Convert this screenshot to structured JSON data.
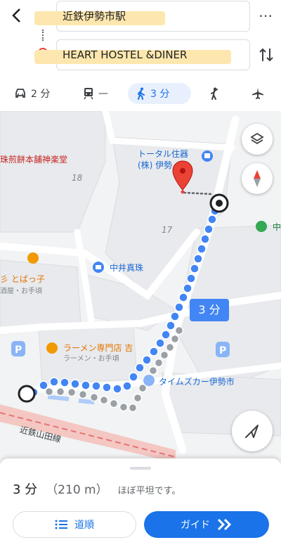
{
  "route": {
    "origin": "近鉄伊勢市駅",
    "destination": "HEART HOSTEL &DINER"
  },
  "modes": [
    {
      "name": "car",
      "label": "2 分"
    },
    {
      "name": "transit",
      "label": "—"
    },
    {
      "name": "walk",
      "label": "3 分",
      "active": true
    },
    {
      "name": "ride",
      "label": ""
    },
    {
      "name": "flight",
      "label": ""
    }
  ],
  "map": {
    "labels": {
      "shop1": "珠煎餅本舗神楽堂",
      "block18": "18",
      "total_housing_1": "トータル住器",
      "total_housing_2": "(株) 伊勢",
      "block17": "17",
      "nakai_shinju": "中井真珠",
      "tobakko_1": "彡 とばっ子",
      "tobakko_2": "酒屋・お手頃",
      "ramen_1": "ラーメン専門店 吉",
      "ramen_2": "ラーメン・お手頃",
      "times_car": "タイムズカー伊勢市",
      "line_name": "近鉄山田線",
      "right_edge": "中"
    },
    "duration_bubble": "3 分"
  },
  "summary": {
    "duration": "3 分",
    "distance": "（210 m）",
    "note": "ほぼ平坦です。"
  },
  "buttons": {
    "steps": "道順",
    "guide": "ガイド"
  },
  "colors": {
    "route_blue": "#4285f4",
    "accent": "#1a73e8",
    "pin_red": "#ea4335",
    "highlight": "#fde7ae"
  }
}
